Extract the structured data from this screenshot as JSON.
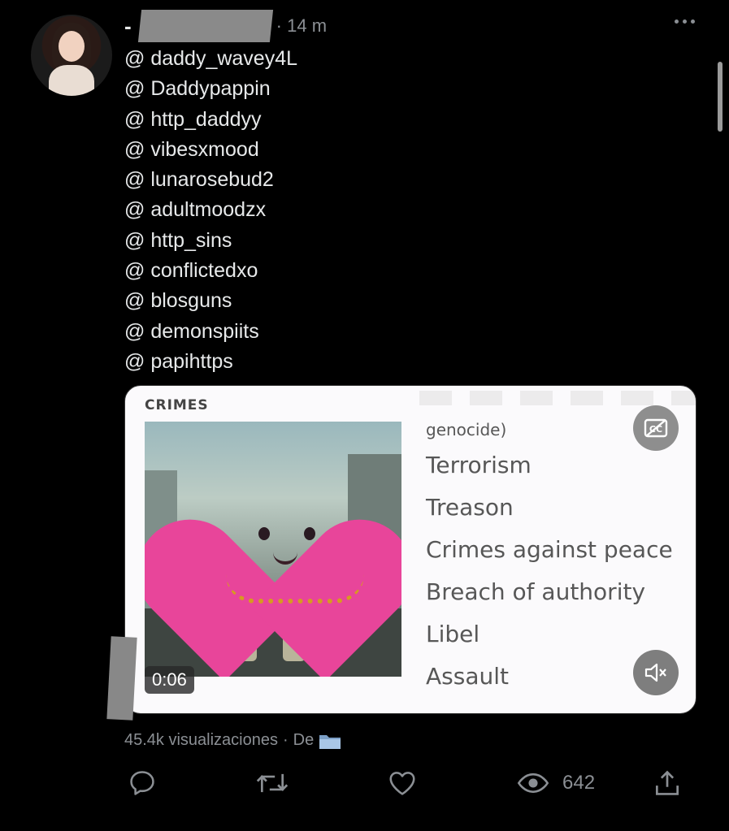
{
  "header": {
    "dash": "-",
    "time": "· 14 m"
  },
  "tweet": {
    "mentions": [
      "@ daddy_wavey4L",
      "@ Daddypappin",
      "@ http_daddyy",
      "@ vibesxmood",
      "@ lunarosebud2",
      "@ adultmoodzx",
      "@ http_sins",
      "@ conflictedxo",
      "@ blosguns",
      "@ demonspiits",
      "@ papihttps"
    ]
  },
  "media": {
    "heading": "CRIMES",
    "list_items": [
      "genocide)",
      "Terrorism",
      "Treason",
      "Crimes against peace",
      "Breach of authority",
      "Libel",
      "Assault"
    ],
    "duration": "0:06"
  },
  "footer": {
    "views": "45.4k visualizaciones",
    "separator": "·",
    "from": "De",
    "view_count": "642"
  },
  "colors": {
    "background": "#000000",
    "text": "#e7e9ea",
    "muted": "#8b8f94",
    "card": "#fbfafc"
  }
}
